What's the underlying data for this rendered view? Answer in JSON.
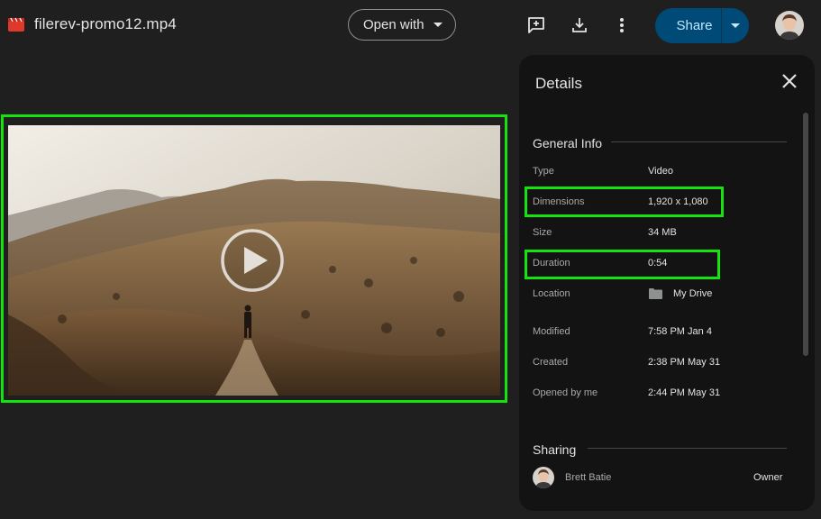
{
  "file": {
    "name": "filerev-promo12.mp4",
    "icon": "video-file-icon"
  },
  "toolbar": {
    "open_with_label": "Open with",
    "add_comment_icon": "add-comment-icon",
    "download_icon": "download-icon",
    "more_icon": "more-vert-icon",
    "share_label": "Share",
    "accent": "#004a77"
  },
  "details": {
    "title": "Details",
    "general_info_title": "General Info",
    "rows": [
      {
        "label": "Type",
        "value": "Video"
      },
      {
        "label": "Dimensions",
        "value": "1,920 x 1,080"
      },
      {
        "label": "Size",
        "value": "34 MB"
      },
      {
        "label": "Duration",
        "value": "0:54"
      },
      {
        "label": "Location",
        "value": "My Drive"
      },
      {
        "label": "Modified",
        "value": "7:58 PM Jan 4"
      },
      {
        "label": "Created",
        "value": "2:38 PM May 31"
      },
      {
        "label": "Opened by me",
        "value": "2:44 PM May 31"
      }
    ],
    "sharing_title": "Sharing",
    "owner": {
      "name": "Brett Batie",
      "role": "Owner"
    }
  },
  "highlight_color": "#14e30d"
}
